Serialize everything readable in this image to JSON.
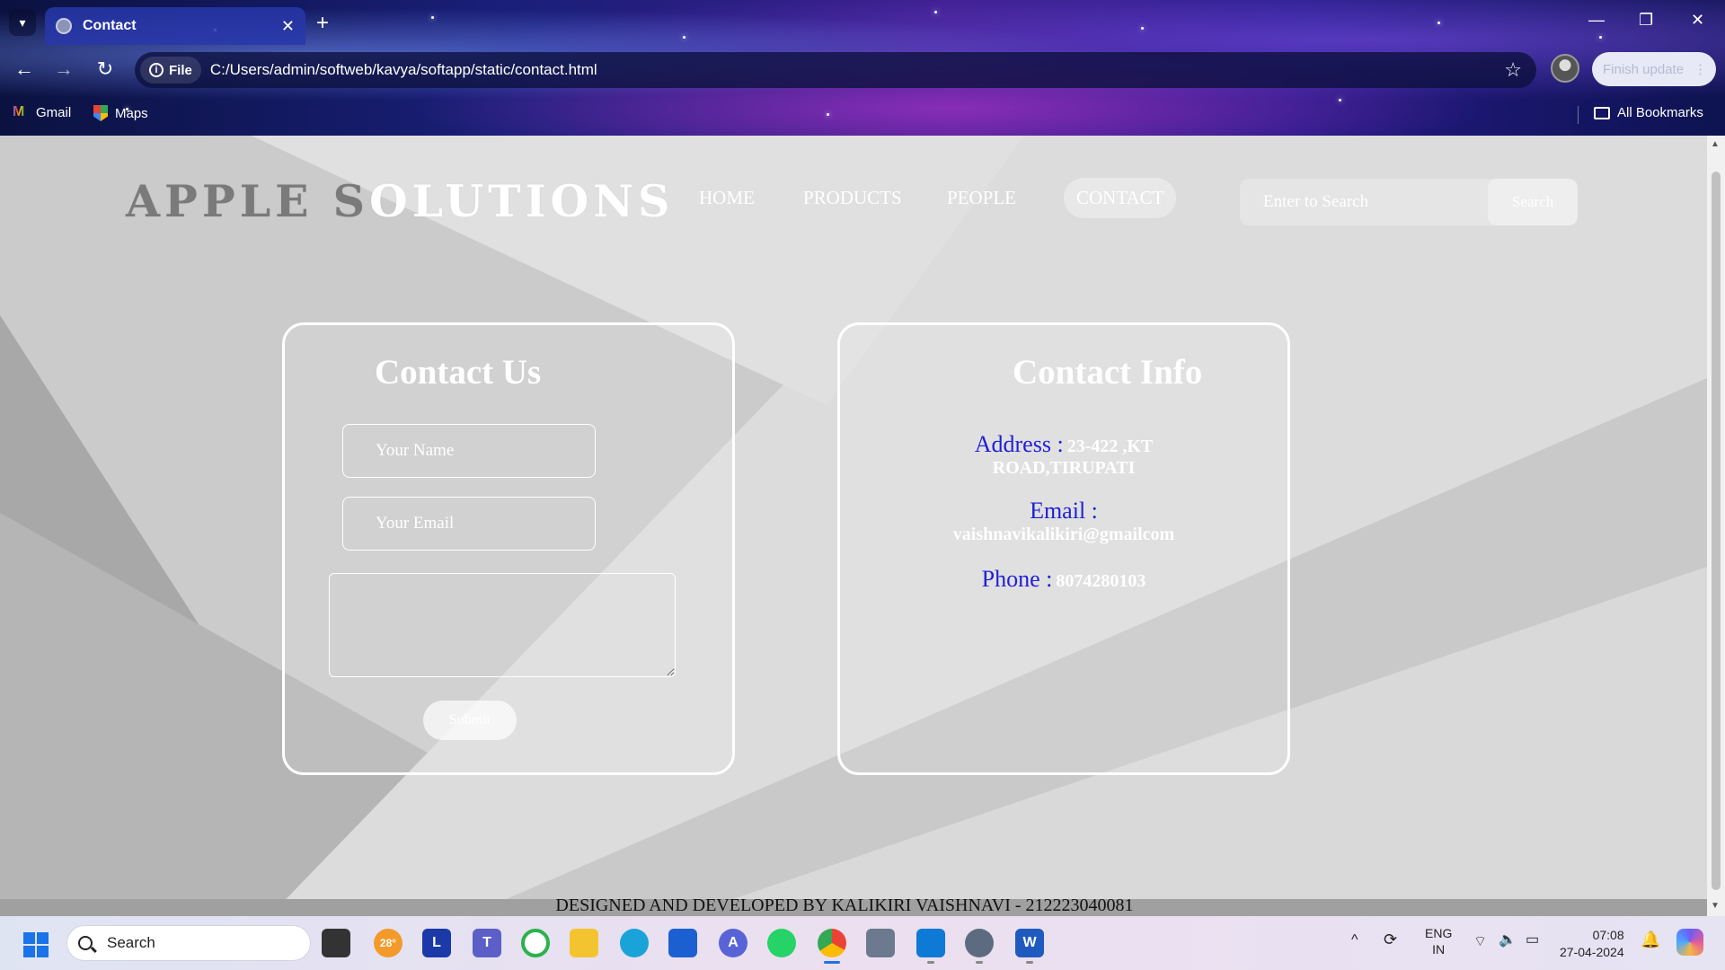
{
  "browser": {
    "tab_title": "Contact",
    "address_chip": "File",
    "url": "C:/Users/admin/softweb/kavya/softapp/static/contact.html",
    "update_button": "Finish update",
    "bookmarks": [
      {
        "label": "Gmail",
        "icon": "gmail-icon"
      },
      {
        "label": "Maps",
        "icon": "maps-icon"
      }
    ],
    "all_bookmarks": "All Bookmarks"
  },
  "site": {
    "logo_part1": "APPLE",
    "logo_part2": "S",
    "logo_part3": "OLUTIONS",
    "nav": [
      "HOME",
      "PRODUCTS",
      "PEOPLE",
      "CONTACT"
    ],
    "active_nav": "CONTACT",
    "search_placeholder": "Enter to Search",
    "search_button": "Search"
  },
  "contact_form": {
    "title": "Contact Us",
    "name_placeholder": "Your Name",
    "email_placeholder": "Your Email",
    "message_value": "",
    "submit_label": "Submit"
  },
  "contact_info": {
    "title": "Contact Info",
    "address_label": "Address :",
    "address_line1": "23-422 ,KT",
    "address_line2": "ROAD,TIRUPATI",
    "email_label": "Email :",
    "email_value": "vaishnavikalikiri@gmailcom",
    "phone_label": "Phone :",
    "phone_value": "8074280103"
  },
  "footer": {
    "text": "DESIGNED AND DEVELOPED BY KALIKIRI VAISHNAVI - 212223040081"
  },
  "taskbar": {
    "search_label": "Search",
    "weather": "28°",
    "language_line1": "ENG",
    "language_line2": "IN",
    "time": "07:08",
    "date": "27-04-2024"
  },
  "colors": {
    "info_label": "#1f1fd6",
    "chrome_accent": "#2837aa"
  }
}
